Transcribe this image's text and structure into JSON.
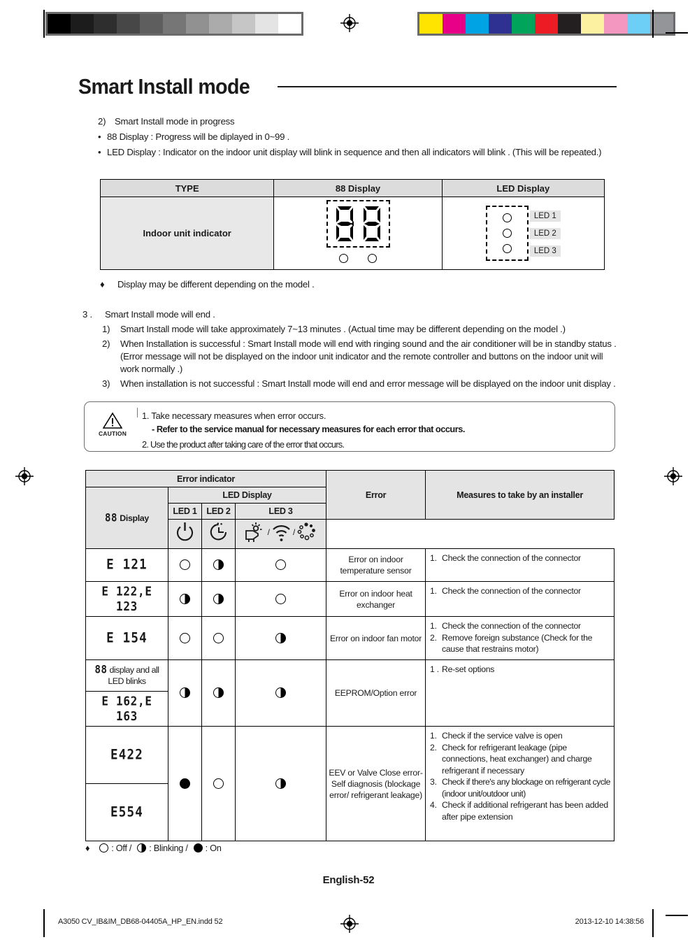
{
  "print_marks": {
    "gray_swatches": [
      "#000000",
      "#1c1c1c",
      "#2e2e2e",
      "#474747",
      "#5e5e5e",
      "#767676",
      "#919191",
      "#ababab",
      "#c6c6c6",
      "#e4e4e4",
      "#ffffff"
    ],
    "color_swatches": [
      "#ffe400",
      "#e80089",
      "#00a4e4",
      "#2e3192",
      "#00a55b",
      "#ed1c24",
      "#231f20",
      "#fbf1a0",
      "#f497c0",
      "#6ecff6",
      "#939598"
    ],
    "file_name": "A3050 CV_IB&IM_DB68-04405A_HP_EN.indd   52",
    "timestamp": "2013-12-10   14:38:56"
  },
  "header": {
    "title": "Smart Install mode"
  },
  "intro": {
    "item2_num": "2)",
    "item2_text": "Smart Install mode in progress",
    "bullet": "•",
    "b1": "88 Display : Progress will be diplayed in 0~99 .",
    "b2": "LED Display : Indicator on the indoor unit display will blink in sequence and then all indicators will blink . (This will be repeated.)"
  },
  "table1": {
    "headers": [
      "TYPE",
      "88 Display",
      "LED Display"
    ],
    "row_label": "Indoor unit indicator",
    "seg_value": "88",
    "led_labels": [
      "LED 1",
      "LED 2",
      "LED 3"
    ]
  },
  "note": {
    "marker": "♦",
    "text": "Display may be different depending on the model ."
  },
  "section3": {
    "num": "3 .",
    "heading": "Smart Install mode will end .",
    "items": [
      {
        "num": "1)",
        "text": "Smart Install mode will take approximately 7~13 minutes . (Actual time may be different depending on the model .)"
      },
      {
        "num": "2)",
        "text": "When Installation is successful : Smart Install mode will end with ringing sound and the air conditioner will be in standby status . (Error message will not be displayed on the indoor unit indicator and the remote controller and buttons on the indoor unit will work normally .)"
      },
      {
        "num": "3)",
        "text": "When installation is not successful : Smart Install mode will end and error message will be displayed on the indoor unit display ."
      }
    ]
  },
  "caution": {
    "word": "CAUTION",
    "line1": "1. Take necessary measures when error occurs.",
    "line2": "-  Refer to the service manual for necessary measures for each error that occurs.",
    "line3": "2. Use the product after taking care of the error that occurs."
  },
  "error_table": {
    "headers": {
      "error_indicator": "Error indicator",
      "led_display": "LED Display",
      "display88_seg": "88",
      "display88_word": "Display",
      "led1": "LED 1",
      "led2": "LED 2",
      "led3": "LED 3",
      "error": "Error",
      "measures": "Measures to take by an installer"
    },
    "rows": [
      {
        "code": "E 121",
        "code_style": "seg",
        "led1": "off",
        "led2": "blink",
        "led3": "off",
        "error": "Error on indoor temperature  sensor",
        "measures": [
          {
            "n": "1.",
            "t": "Check the connection of the connector"
          }
        ]
      },
      {
        "code": "E 122,E 123",
        "code_style": "seg",
        "led1": "blink",
        "led2": "blink",
        "led3": "off",
        "error": "Error on indoor heat exchanger",
        "measures": [
          {
            "n": "1.",
            "t": "Check the connection of the connector"
          }
        ]
      },
      {
        "code": "E 154",
        "code_style": "seg",
        "led1": "off",
        "led2": "off",
        "led3": "blink",
        "error": "Error on indoor fan motor",
        "measures": [
          {
            "n": "1.",
            "t": "Check the connection of the connector"
          },
          {
            "n": "2.",
            "t": "Remove foreign substance (Check for the cause that restrains motor)"
          }
        ]
      },
      {
        "code_blink_seg": "88",
        "code_blink_text": " display and all LED blinks",
        "code2": "E 162,E 163",
        "led1": "blink",
        "led2": "blink",
        "led3": "blink",
        "error": "EEPROM/Option  error",
        "measures": [
          {
            "n": "1 .",
            "t": "Re-set options"
          }
        ]
      },
      {
        "code": "E422",
        "code_b": "E554",
        "code_style": "seg",
        "led1": "on",
        "led2": "off",
        "led3": "blink",
        "error": "EEV or Valve Close error-Self diagnosis (blockage  error/ refrigerant  leakage)",
        "measures": [
          {
            "n": "1.",
            "t": "Check if the service valve is open"
          },
          {
            "n": "2.",
            "t": "Check for refrigerant leakage (pipe connections, heat exchanger) and charge refrigerant if necessary"
          },
          {
            "n": "3.",
            "t": "Check if there's any blockage on refrigerant cycle (indoor unit/outdoor unit)"
          },
          {
            "n": "4.",
            "t": "Check if additional refrigerant has been added after pipe extension"
          }
        ]
      }
    ]
  },
  "legend": {
    "marker": "♦",
    "off": ": Off /",
    "blinking": ": Blinking /",
    "on": ": On"
  },
  "footer": {
    "page": "English-52"
  }
}
